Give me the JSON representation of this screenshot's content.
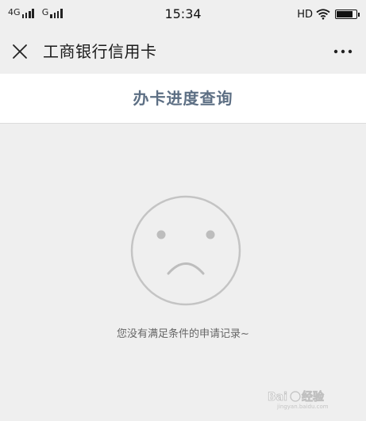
{
  "status_bar": {
    "network_1": "4G",
    "network_2": "G",
    "time": "15:34",
    "hd": "HD",
    "battery_level": 0.85
  },
  "title_bar": {
    "close_icon": "close-icon",
    "title": "工商银行信用卡",
    "more_icon": "more-dots-icon"
  },
  "page_header": {
    "title": "办卡进度查询"
  },
  "empty_state": {
    "icon": "sad-face-icon",
    "message": "您没有满足条件的申请记录~"
  },
  "watermark": {
    "text": "Baidu 经验",
    "sub": "jingyan.baidu.com"
  },
  "colors": {
    "background": "#efefef",
    "header_bg": "#ffffff",
    "page_title": "#5d6f84",
    "face_stroke": "#c4c4c4",
    "message_text": "#666666"
  }
}
